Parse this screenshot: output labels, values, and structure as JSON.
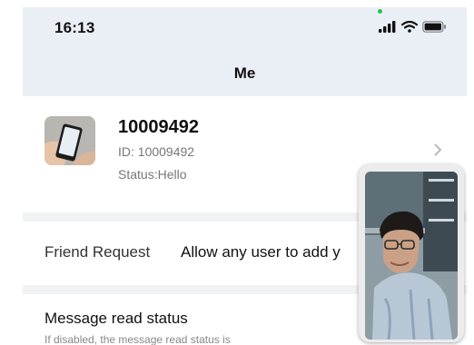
{
  "status_bar": {
    "time": "16:13",
    "icons": [
      "signal-icon",
      "wifi-icon",
      "battery-icon"
    ],
    "camera_indicator_color": "#2fc14b"
  },
  "header": {
    "title": "Me",
    "background": "#eaeef5"
  },
  "profile": {
    "name": "10009492",
    "id_text": "ID: 10009492",
    "status_text": "Status:Hello"
  },
  "settings": {
    "friend_request": {
      "label": "Friend Request",
      "value": "Allow any user to add y"
    },
    "message_read_status": {
      "title": "Message read status",
      "description": "If disabled, the message read status is"
    }
  },
  "video_call": {
    "state": "picture-in-picture"
  }
}
